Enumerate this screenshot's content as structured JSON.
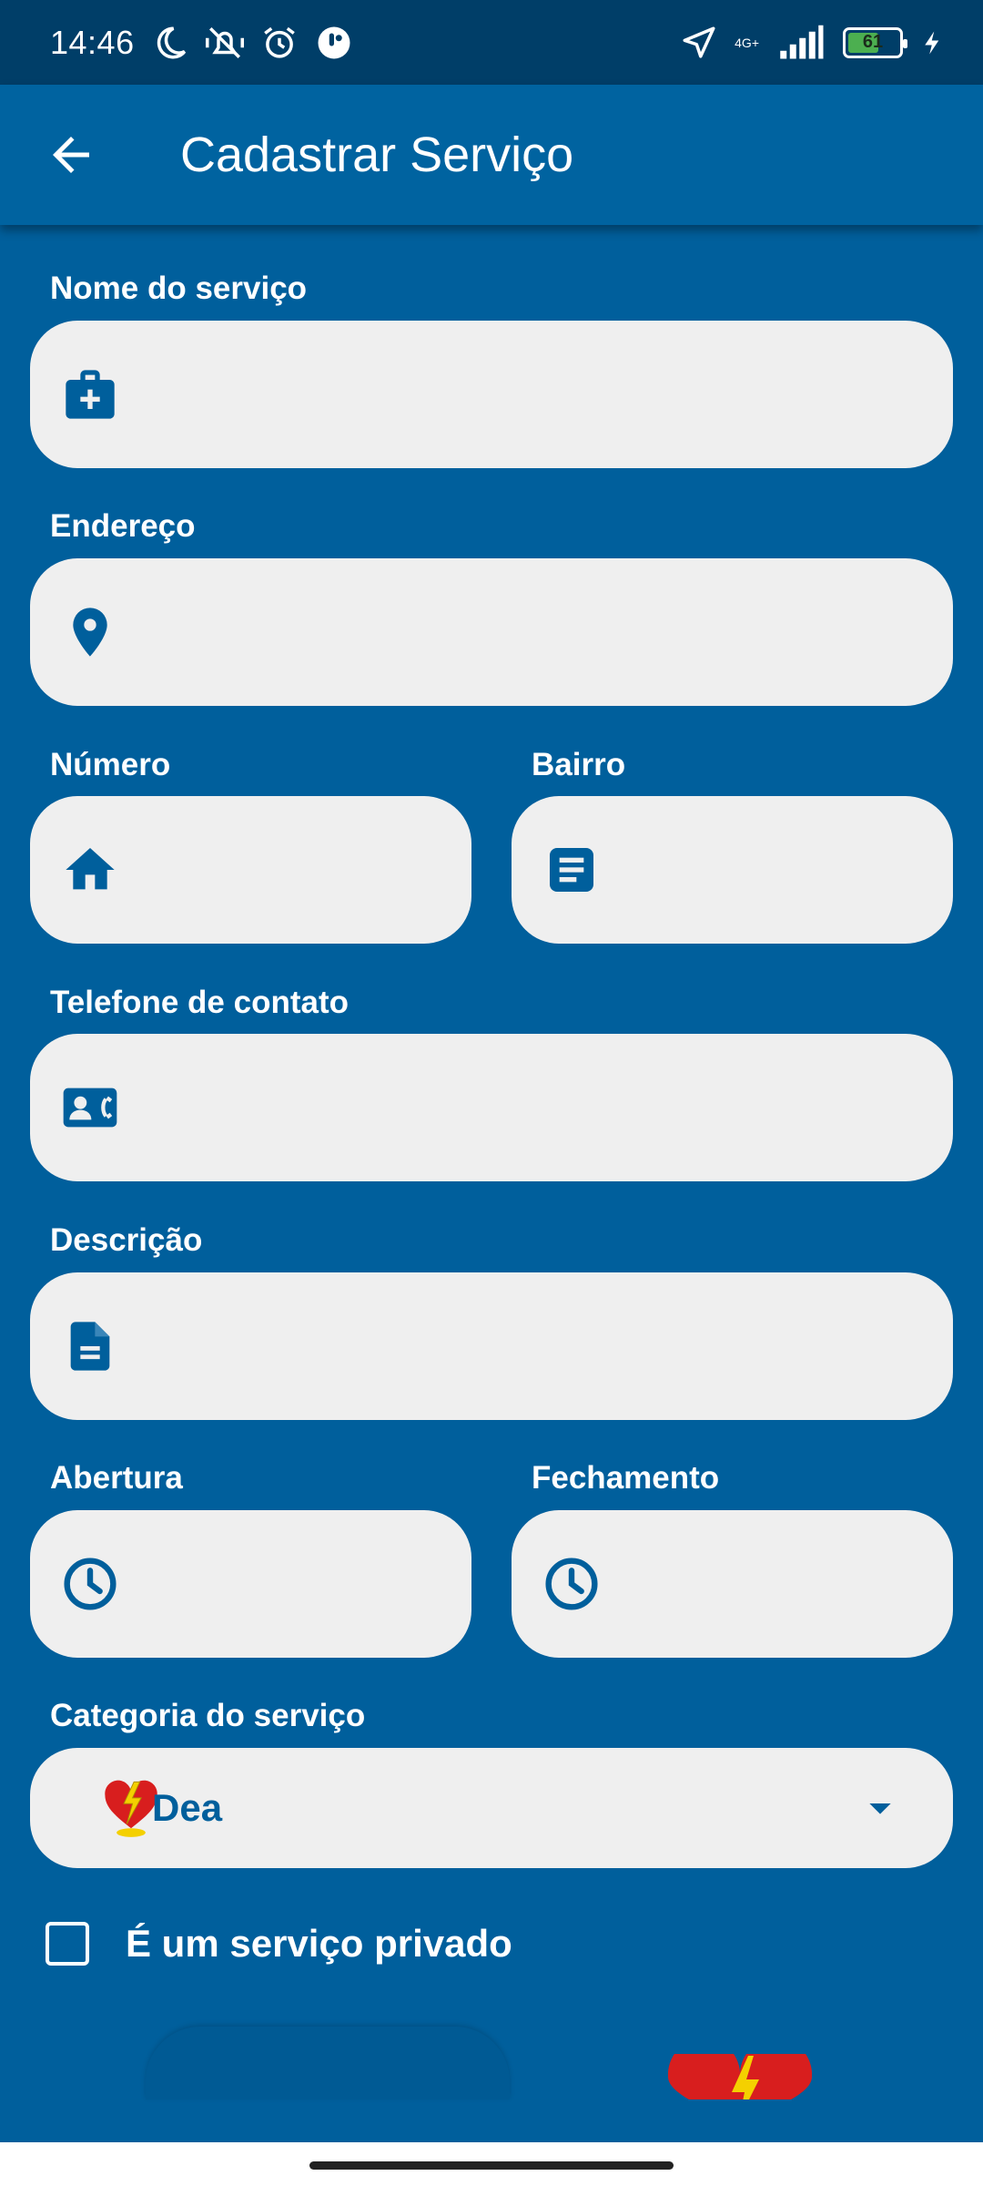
{
  "status_bar": {
    "time": "14:46",
    "network": "4G+",
    "battery": "61",
    "battery_level": 0.61
  },
  "app_bar": {
    "title": "Cadastrar Serviço",
    "back_icon": "arrow-back-icon"
  },
  "form": {
    "nome": {
      "label": "Nome do serviço",
      "value": "",
      "icon": "medical-bag-icon"
    },
    "endereco": {
      "label": "Endereço",
      "value": "",
      "icon": "location-pin-icon"
    },
    "numero": {
      "label": "Número",
      "value": "",
      "icon": "home-icon"
    },
    "bairro": {
      "label": "Bairro",
      "value": "",
      "icon": "article-icon"
    },
    "telefone": {
      "label": "Telefone de contato",
      "value": "",
      "icon": "contact-phone-icon"
    },
    "descricao": {
      "label": "Descrição",
      "value": "",
      "icon": "document-icon"
    },
    "abertura": {
      "label": "Abertura",
      "value": "",
      "icon": "clock-icon"
    },
    "fechamento": {
      "label": "Fechamento",
      "value": "",
      "icon": "clock-icon"
    },
    "categoria": {
      "label": "Categoria do serviço",
      "selected": "Dea",
      "icon": "dea-heart-icon"
    },
    "privado": {
      "label": "É um serviço privado",
      "checked": false
    }
  },
  "colors": {
    "background": "#005f9c",
    "app_bar": "#0063a0",
    "status_bar": "#003e68",
    "field": "#efefef",
    "accent": "#005f9c"
  }
}
